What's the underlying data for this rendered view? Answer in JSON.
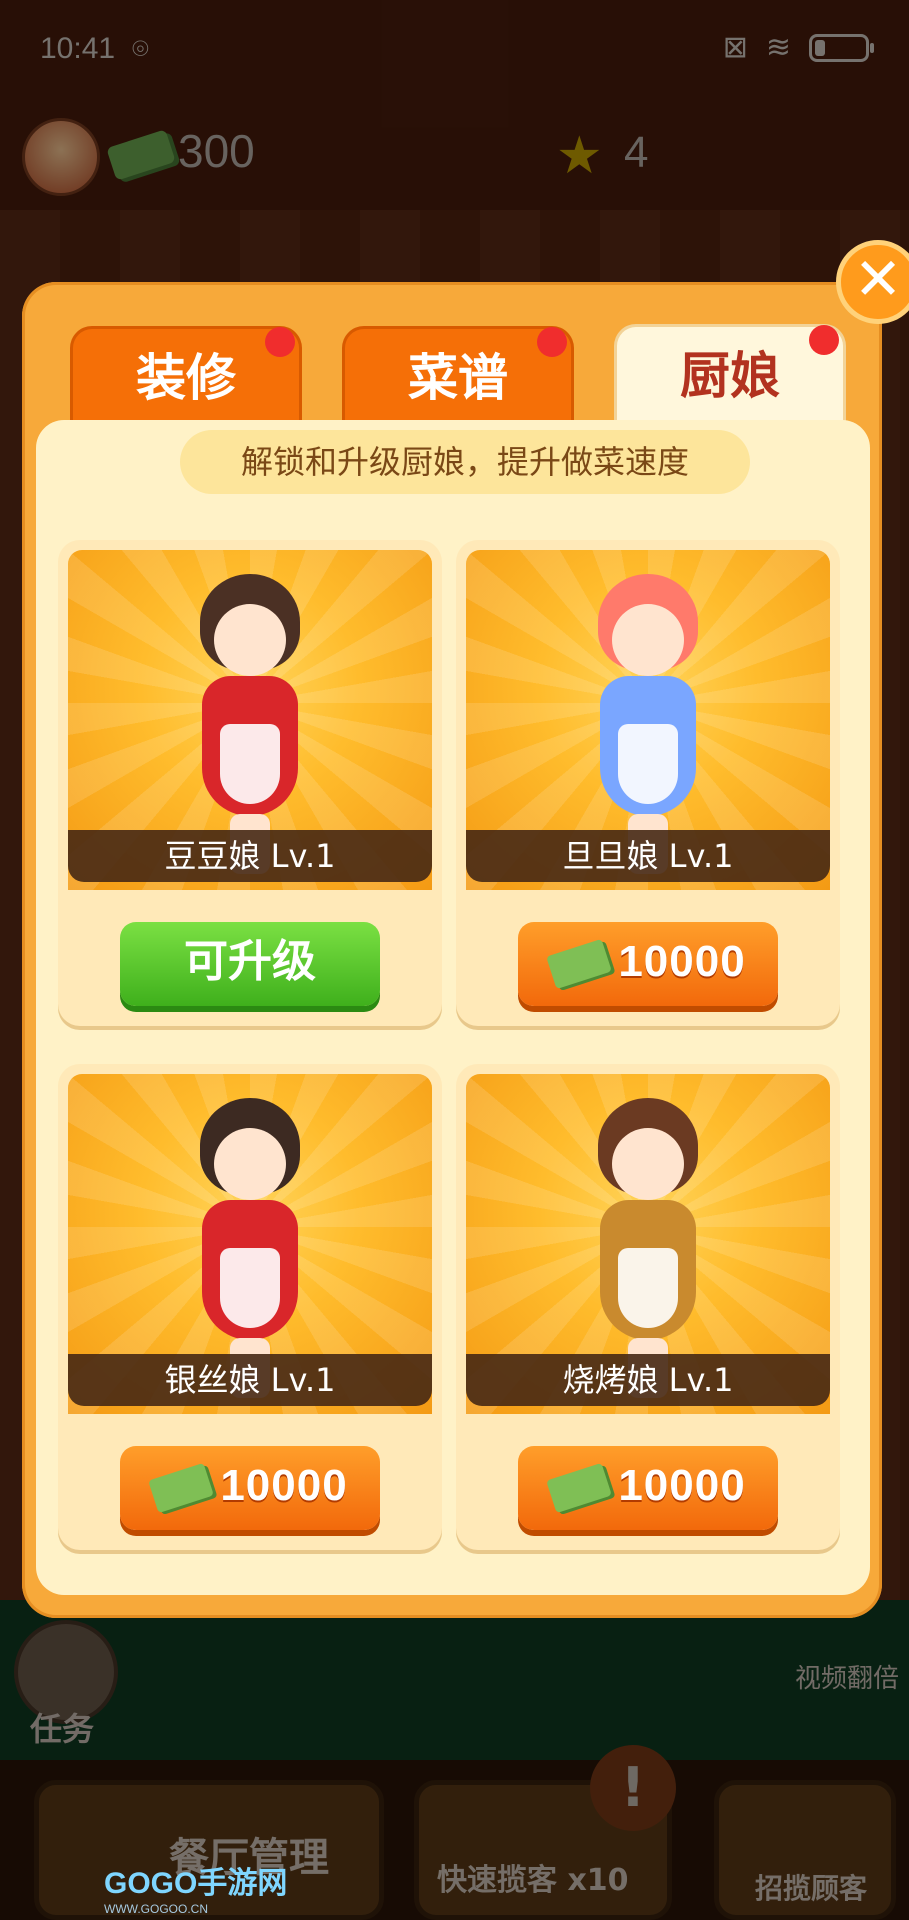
{
  "status_bar": {
    "time": "10:41",
    "location_icon": "location-icon",
    "battery_percent": 20
  },
  "hud": {
    "cash": "300",
    "stars": "4"
  },
  "modal": {
    "close_symbol": "✕",
    "tabs": [
      {
        "label": "装修",
        "active": false,
        "badge": true
      },
      {
        "label": "菜谱",
        "active": false,
        "badge": true
      },
      {
        "label": "厨娘",
        "active": true,
        "badge": true
      }
    ],
    "hint": "解锁和升级厨娘，提升做菜速度",
    "cards": [
      {
        "name": "豆豆娘 Lv.1",
        "action": "可升级",
        "hair_color": "#4b3024",
        "outfit_color": "#d9262a"
      },
      {
        "name": "旦旦娘 Lv.1",
        "price": "10000",
        "hair_color": "#ff7a6b",
        "outfit_color": "#7aa6ff"
      },
      {
        "name": "银丝娘 Lv.1",
        "price": "10000",
        "hair_color": "#3d2a22",
        "outfit_color": "#d9262a"
      },
      {
        "name": "烧烤娘 Lv.1",
        "price": "10000",
        "hair_color": "#6b3a22",
        "outfit_color": "#c98a2e"
      }
    ]
  },
  "bottom": {
    "task": "任务",
    "video_double": "视频翻倍",
    "manage": "餐厅管理",
    "fast": "快速揽客 x10",
    "recruit": "招揽顾客",
    "warn": "!"
  },
  "watermark": {
    "brand": "GOGO手游网",
    "url": "WWW.GOGOO.CN"
  }
}
